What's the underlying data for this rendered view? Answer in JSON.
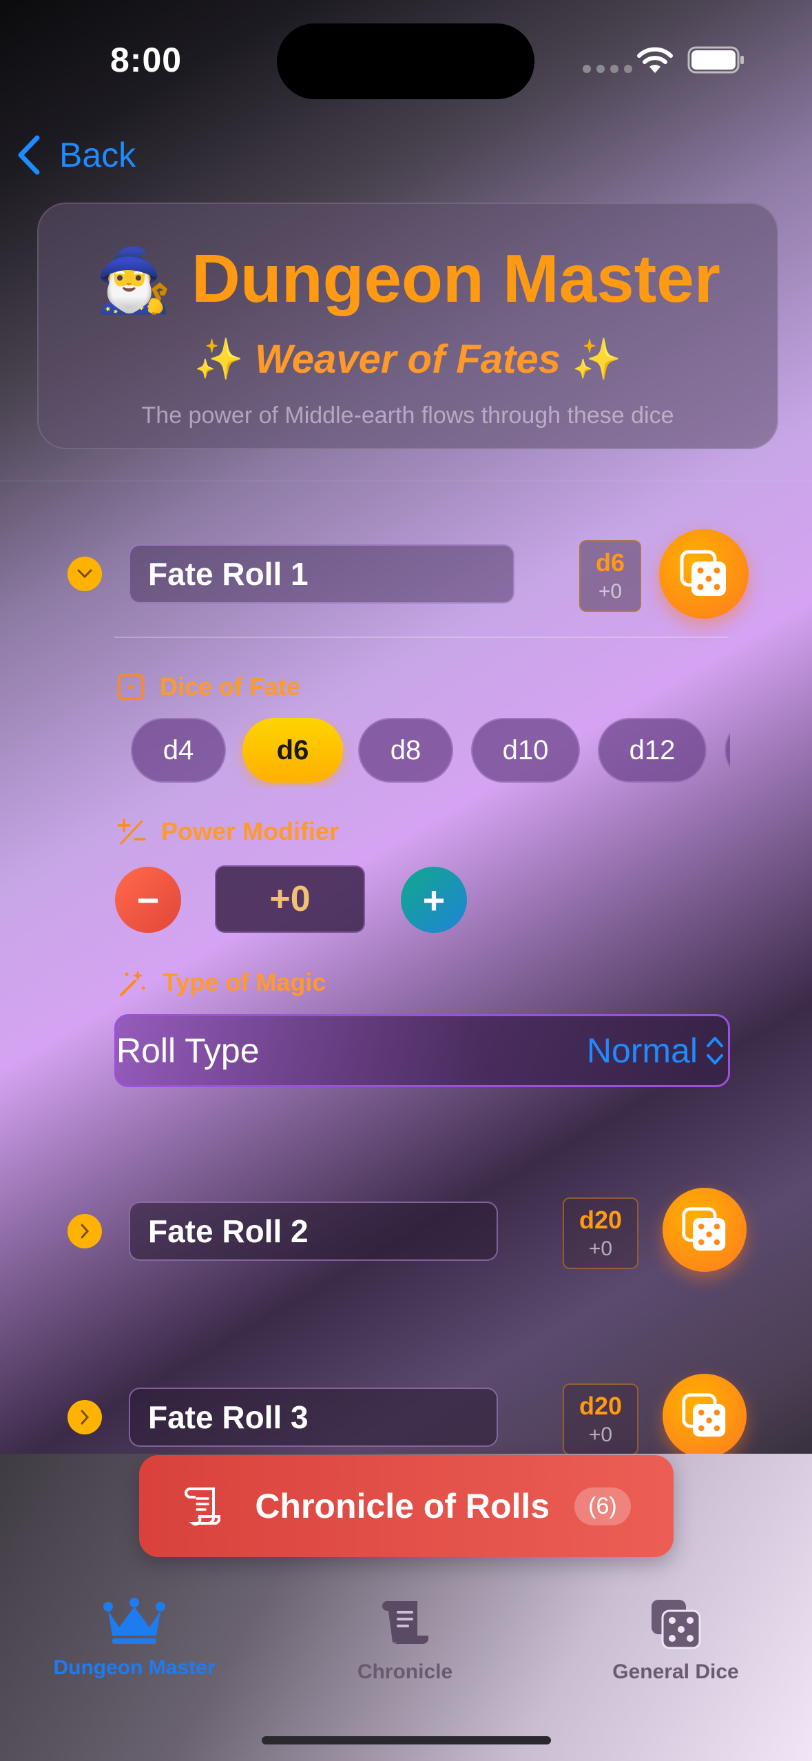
{
  "status": {
    "time": "8:00"
  },
  "nav": {
    "back_label": "Back"
  },
  "hero": {
    "emoji": "🧙‍♂️",
    "title": "Dungeon Master",
    "sparkle": "✨",
    "subtitle": "Weaver of Fates",
    "description": "The power of Middle-earth flows through these dice"
  },
  "rolls": [
    {
      "name": "Fate Roll 1",
      "die": "d6",
      "modifier": "+0",
      "expanded": true
    },
    {
      "name": "Fate Roll 2",
      "die": "d20",
      "modifier": "+0",
      "expanded": false
    },
    {
      "name": "Fate Roll 3",
      "die": "d20",
      "modifier": "+0",
      "expanded": false
    }
  ],
  "editor": {
    "dice_label": "Dice of Fate",
    "dice_options": [
      "d4",
      "d6",
      "d8",
      "d10",
      "d12"
    ],
    "selected_die": "d6",
    "modifier_label": "Power Modifier",
    "modifier_value": "+0",
    "minus_symbol": "−",
    "plus_symbol": "+",
    "magic_label": "Type of Magic",
    "roll_type_label": "Roll Type",
    "roll_type_value": "Normal"
  },
  "chronicle_button": {
    "label": "Chronicle of Rolls",
    "count": "(6)"
  },
  "tabs": [
    {
      "label": "Dungeon Master",
      "icon": "crown-icon",
      "active": true
    },
    {
      "label": "Chronicle",
      "icon": "scroll-icon",
      "active": false
    },
    {
      "label": "General Dice",
      "icon": "dice-icon",
      "active": false
    }
  ],
  "colors": {
    "accent_orange": "#ff9a12",
    "selected_pill": "#ffc400",
    "ios_blue": "#1e8bff",
    "chronicle_red": "#e24e46"
  }
}
